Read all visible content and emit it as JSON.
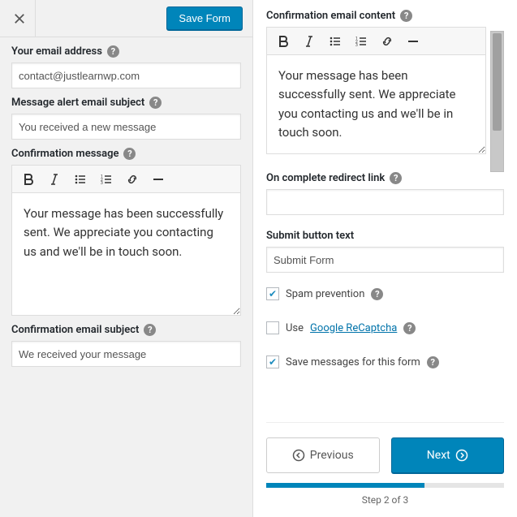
{
  "topbar": {
    "save_label": "Save Form"
  },
  "left": {
    "email_label": "Your email address",
    "email_value": "contact@justlearnwp.com",
    "alert_subject_label": "Message alert email subject",
    "alert_subject_value": "You received a new message",
    "conf_msg_label": "Confirmation message",
    "conf_msg_value": "Your message has been successfully sent. We appreciate you contacting us and we'll be in touch soon.",
    "conf_email_subject_label": "Confirmation email subject",
    "conf_email_subject_value": "We received your message"
  },
  "right": {
    "conf_email_content_label": "Confirmation email content",
    "conf_email_content_value": "Your message has been successfully sent. We appreciate you contacting us and we'll be in touch soon.",
    "redirect_label": "On complete redirect link",
    "redirect_value": "",
    "submit_label": "Submit button text",
    "submit_value": "Submit Form",
    "spam_label": "Spam prevention",
    "recaptcha_prefix": "Use",
    "recaptcha_link": "Google ReCaptcha",
    "savemsg_label": "Save messages for this form"
  },
  "footer": {
    "prev": "Previous",
    "next": "Next",
    "step": "Step 2 of 3"
  },
  "checks": {
    "spam": true,
    "recaptcha": false,
    "savemsg": true
  }
}
